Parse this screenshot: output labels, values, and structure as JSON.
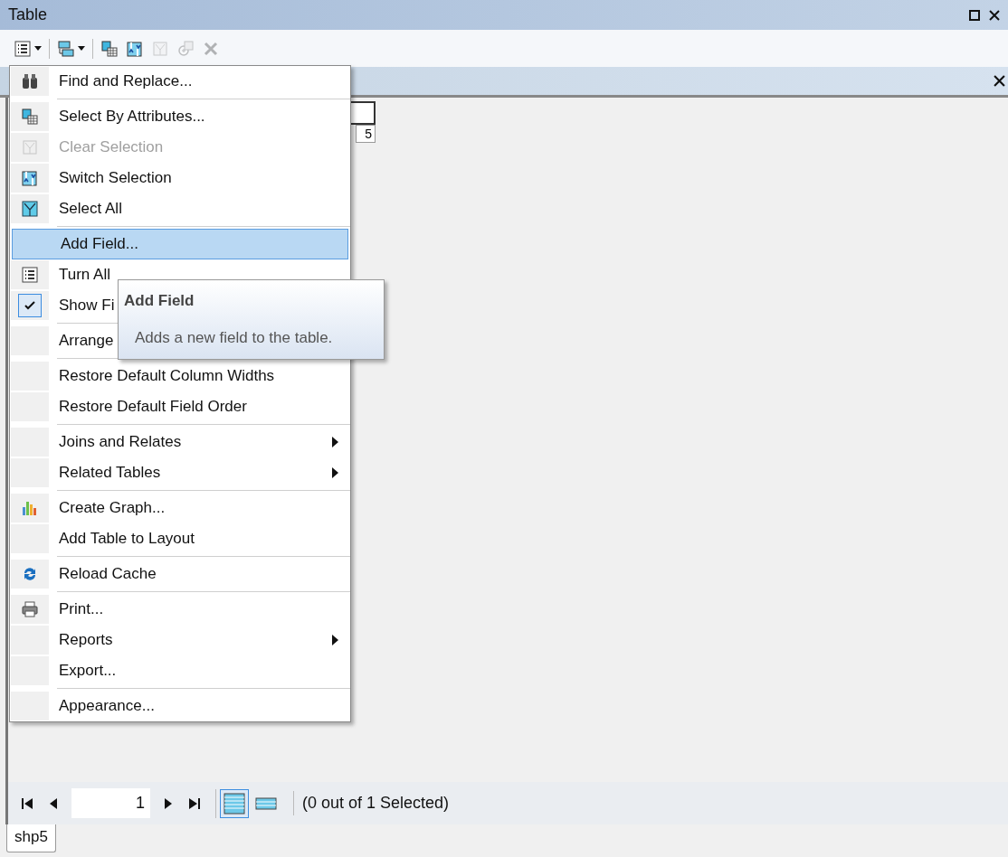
{
  "window": {
    "title": "Table"
  },
  "toolbar": [
    {
      "kind": "dropdown",
      "disabled": false
    },
    {
      "kind": "dropdown",
      "disabled": false
    },
    {
      "kind": "button",
      "disabled": false
    },
    {
      "kind": "button",
      "disabled": false
    },
    {
      "kind": "button",
      "disabled": true
    },
    {
      "kind": "button",
      "disabled": true
    },
    {
      "kind": "button",
      "disabled": true
    }
  ],
  "table": {
    "rows": [
      [
        "5"
      ]
    ]
  },
  "menu": {
    "groups": [
      {
        "items": [
          {
            "label": "Find and Replace...",
            "disabled": false,
            "selected": false,
            "checked": false,
            "submenu": false
          }
        ]
      },
      {
        "items": [
          {
            "label": "Select By Attributes...",
            "disabled": false,
            "selected": false,
            "checked": false,
            "submenu": false
          },
          {
            "label": "Clear Selection",
            "disabled": true,
            "selected": false,
            "checked": false,
            "submenu": false
          },
          {
            "label": "Switch Selection",
            "disabled": false,
            "selected": false,
            "checked": false,
            "submenu": false
          },
          {
            "label": "Select All",
            "disabled": false,
            "selected": false,
            "checked": false,
            "submenu": false
          }
        ]
      },
      {
        "items": [
          {
            "label": "Add Field...",
            "disabled": false,
            "selected": true,
            "checked": false,
            "submenu": false
          },
          {
            "label": "Turn All",
            "disabled": false,
            "selected": false,
            "checked": false,
            "submenu": false
          },
          {
            "label": "Show Fi",
            "disabled": false,
            "selected": false,
            "checked": true,
            "submenu": false
          }
        ]
      },
      {
        "items": [
          {
            "label": "Arrange",
            "disabled": false,
            "selected": false,
            "checked": false,
            "submenu": false
          }
        ]
      },
      {
        "items": [
          {
            "label": "Restore Default Column Widths",
            "disabled": false,
            "selected": false,
            "checked": false,
            "submenu": false
          },
          {
            "label": "Restore Default Field Order",
            "disabled": false,
            "selected": false,
            "checked": false,
            "submenu": false
          }
        ]
      },
      {
        "items": [
          {
            "label": "Joins and Relates",
            "disabled": false,
            "selected": false,
            "checked": false,
            "submenu": true
          },
          {
            "label": "Related Tables",
            "disabled": false,
            "selected": false,
            "checked": false,
            "submenu": true
          }
        ]
      },
      {
        "items": [
          {
            "label": "Create Graph...",
            "disabled": false,
            "selected": false,
            "checked": false,
            "submenu": false
          },
          {
            "label": "Add Table to Layout",
            "disabled": false,
            "selected": false,
            "checked": false,
            "submenu": false
          }
        ]
      },
      {
        "items": [
          {
            "label": "Reload Cache",
            "disabled": false,
            "selected": false,
            "checked": false,
            "submenu": false
          }
        ]
      },
      {
        "items": [
          {
            "label": "Print...",
            "disabled": false,
            "selected": false,
            "checked": false,
            "submenu": false
          },
          {
            "label": "Reports",
            "disabled": false,
            "selected": false,
            "checked": false,
            "submenu": true
          },
          {
            "label": "Export...",
            "disabled": false,
            "selected": false,
            "checked": false,
            "submenu": false
          }
        ]
      },
      {
        "items": [
          {
            "label": "Appearance...",
            "disabled": false,
            "selected": false,
            "checked": false,
            "submenu": false
          }
        ]
      }
    ]
  },
  "tooltip": {
    "title": "Add Field",
    "text": "Adds a new field to the table."
  },
  "navigator": {
    "record": "1",
    "views": [
      {
        "selected": true
      },
      {
        "selected": false
      }
    ],
    "status": "(0 out of 1 Selected)"
  },
  "tabs": [
    {
      "label": "shp5",
      "selected": true
    }
  ]
}
